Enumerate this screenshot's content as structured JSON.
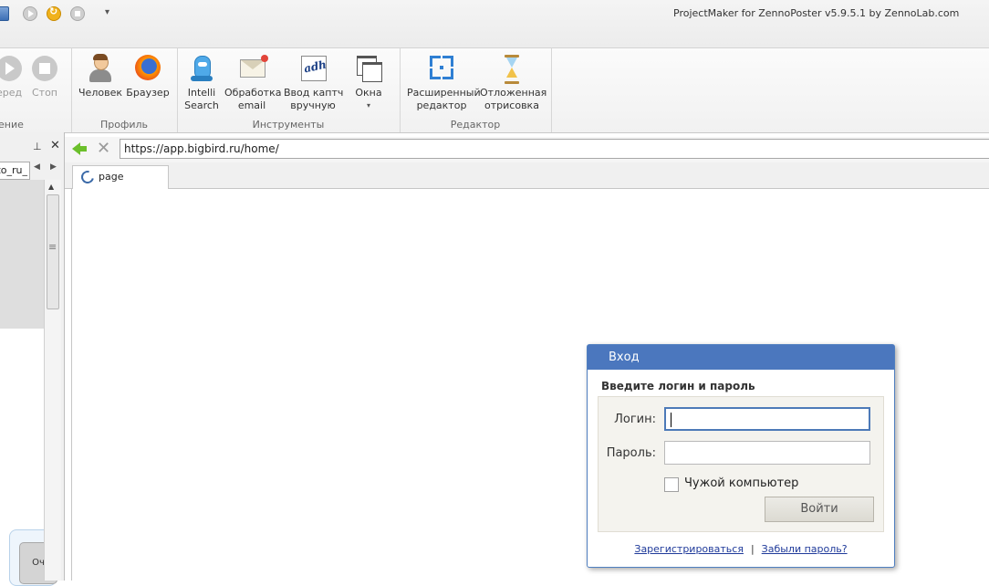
{
  "window": {
    "title": "ProjectMaker for ZennoPoster v5.9.5.1 by ZennoLab.com",
    "quick_access_more": "▾"
  },
  "ribbon": {
    "group_playback": {
      "label": "ение",
      "forward_label": "еред",
      "stop_label": "Стоп"
    },
    "group_profile": {
      "label": "Профиль",
      "person_label": "Человек",
      "browser_label": "Браузер"
    },
    "group_tools": {
      "label": "Инструменты",
      "intelli_label_1": "Intelli",
      "intelli_label_2": "Search",
      "email_label_1": "Обработка",
      "email_label_2": "email",
      "captcha_label_1": "Ввод каптч",
      "captcha_label_2": "вручную",
      "captcha_icon_text": "adh",
      "windows_label": "Окна",
      "windows_arrow": "▾"
    },
    "group_editor": {
      "label": "Редактор",
      "extended_label_1": "Расширенный",
      "extended_label_2": "редактор",
      "deferred_label_1": "Отложенная",
      "deferred_label_2": "отрисовка"
    }
  },
  "left_panel": {
    "pin": "⊥",
    "close": "✕",
    "tab_label": "to_ru_",
    "prev_arrow": "◀",
    "next_arrow": "▶",
    "scroll_up": "▲",
    "node_label": "Оч"
  },
  "browser": {
    "url": "https://app.bigbird.ru/home/",
    "tab_label": "page"
  },
  "login": {
    "title": "Вход",
    "subtitle": "Введите логин и пароль",
    "login_label": "Логин:",
    "login_value": "",
    "password_label": "Пароль:",
    "password_value": "",
    "checkbox_label": "Чужой компьютер",
    "submit_label": "Войти",
    "register_link": "Зарегистрироваться",
    "separator": "|",
    "forgot_link": "Забыли пароль?"
  },
  "colors": {
    "dialog_header": "#4b77be",
    "link": "#1f3a9a",
    "nav_back_arrow": "#6bbf2b"
  }
}
